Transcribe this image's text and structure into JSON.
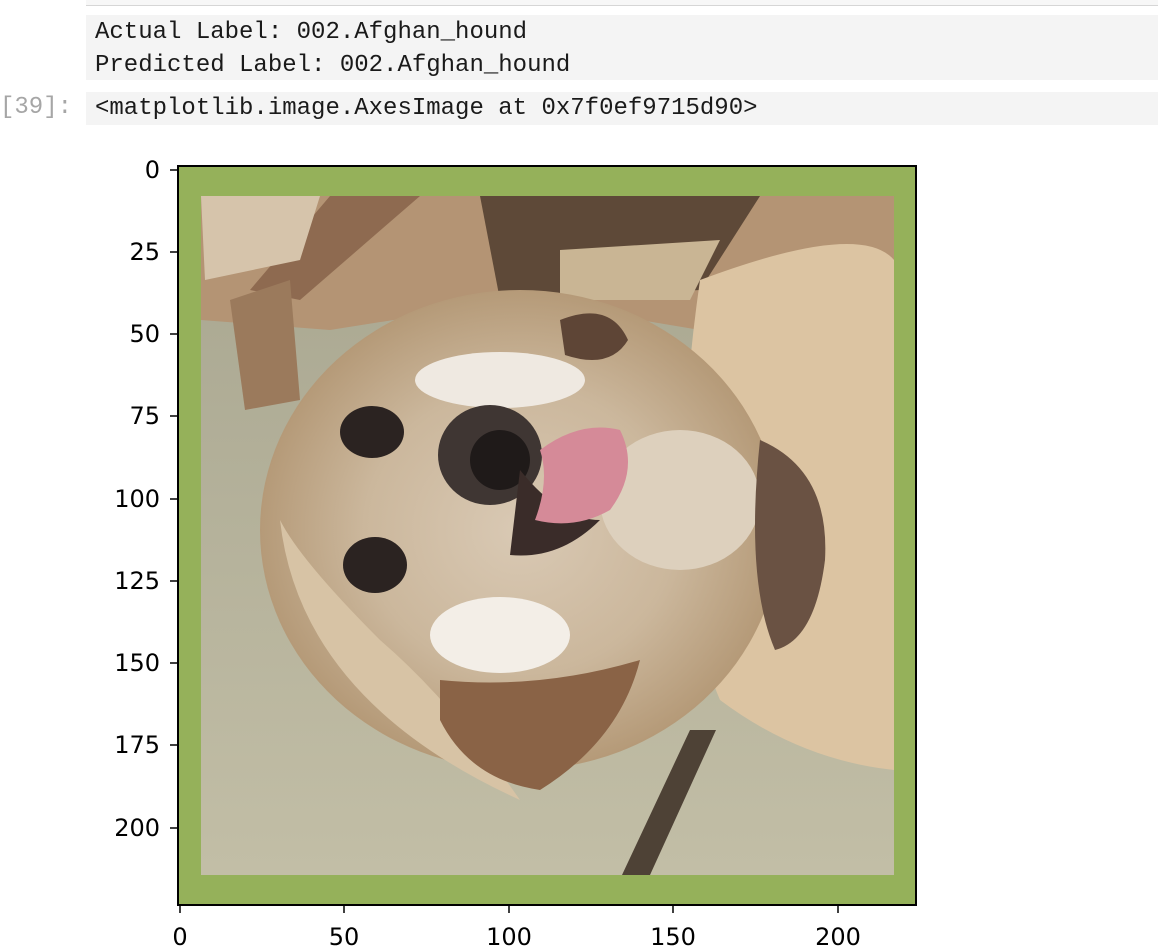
{
  "output": {
    "lines": [
      "Actual Label: 002.Afghan_hound",
      "Predicted Label: 002.Afghan_hound"
    ],
    "prompt": "[39]:",
    "repr": "<matplotlib.image.AxesImage at 0x7f0ef9715d90>"
  },
  "figure": {
    "image_subject": "upside-down Afghan hound photo with green border",
    "border_color": "#95b15a",
    "x_ticks": [
      "0",
      "50",
      "100",
      "150",
      "200"
    ],
    "y_ticks": [
      "0",
      "25",
      "50",
      "75",
      "100",
      "125",
      "150",
      "175",
      "200"
    ],
    "x_range": [
      0,
      224
    ],
    "y_range": [
      0,
      224
    ]
  }
}
